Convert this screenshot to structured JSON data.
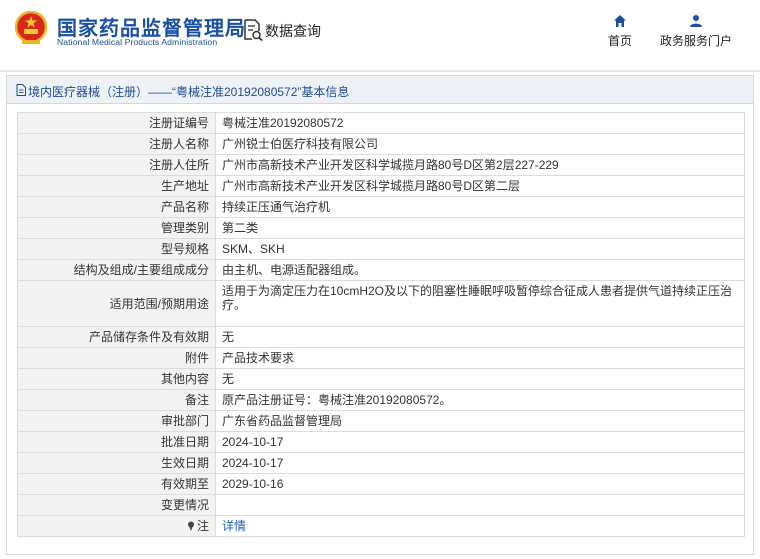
{
  "header": {
    "site_title_cn": "国家药品监督管理局",
    "site_title_en": "National Medical Products Administration",
    "query_label": "数据查询",
    "nav": [
      {
        "label": "首页",
        "icon": "home-icon"
      },
      {
        "label": "政务服务门户",
        "icon": "user-icon"
      }
    ]
  },
  "panel": {
    "title": "境内医疗器械（注册）——“粤械注准20192080572”基本信息"
  },
  "rows": [
    {
      "key": "注册证编号",
      "value": "粤械注准20192080572"
    },
    {
      "key": "注册人名称",
      "value": "广州锐士伯医疗科技有限公司"
    },
    {
      "key": "注册人住所",
      "value": "广州市高新技术产业开发区科学城揽月路80号D区第2层227-229"
    },
    {
      "key": "生产地址",
      "value": "广州市高新技术产业开发区科学城揽月路80号D区第二层"
    },
    {
      "key": "产品名称",
      "value": "持续正压通气治疗机"
    },
    {
      "key": "管理类别",
      "value": "第二类"
    },
    {
      "key": "型号规格",
      "value": "SKM、SKH"
    },
    {
      "key": "结构及组成/主要组成成分",
      "value": "由主机、电源适配器组成。"
    },
    {
      "key": "适用范围/预期用途",
      "value": "适用于为滴定压力在10cmH2O及以下的阻塞性睡眠呼吸暂停综合征成人患者提供气道持续正压治疗。"
    },
    {
      "key": "产品储存条件及有效期",
      "value": "无"
    },
    {
      "key": "附件",
      "value": "产品技术要求"
    },
    {
      "key": "其他内容",
      "value": "无"
    },
    {
      "key": "备注",
      "value": "原产品注册证号：粤械注准20192080572。"
    },
    {
      "key": "审批部门",
      "value": "广东省药品监督管理局"
    },
    {
      "key": "批准日期",
      "value": "2024-10-17"
    },
    {
      "key": "生效日期",
      "value": "2024-10-17"
    },
    {
      "key": "有效期至",
      "value": "2029-10-16"
    },
    {
      "key": "变更情况",
      "value": ""
    },
    {
      "key": "注",
      "value": "详情"
    }
  ],
  "colors": {
    "brand_blue": "#1a4fa3",
    "link_blue": "#1c5fb8",
    "title_bar_bg": "#eef2f7",
    "key_cell_bg": "#f3f3f3"
  }
}
